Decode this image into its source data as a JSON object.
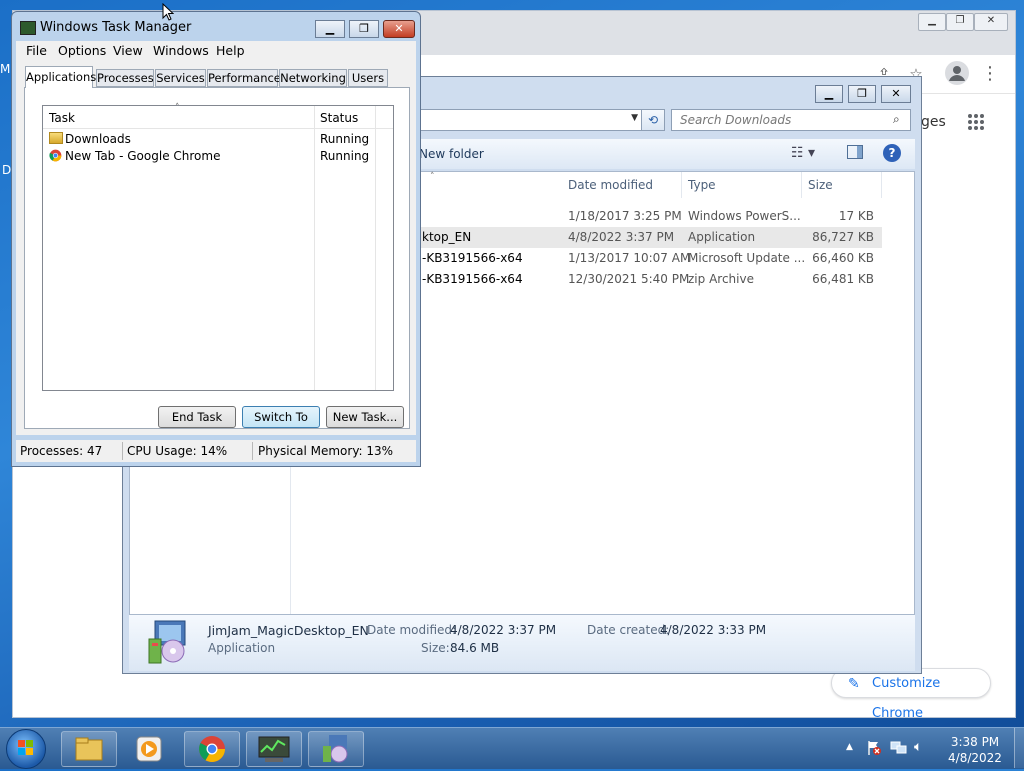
{
  "desktop": {
    "left_letters": [
      "M",
      "D"
    ]
  },
  "chrome": {
    "partial_text": "ges",
    "customize_label": "Customize Chrome",
    "icons": [
      "share-icon",
      "star-icon",
      "profile-icon",
      "menu-icon",
      "apps-grid-icon",
      "pencil-icon"
    ]
  },
  "explorer": {
    "search_placeholder": "Search Downloads",
    "new_folder_label": "New folder",
    "columns": {
      "date": "Date modified",
      "type": "Type",
      "size": "Size"
    },
    "rows": [
      {
        "name": "",
        "date": "1/18/2017 3:25 PM",
        "type": "Windows PowerS...",
        "size": "17 KB"
      },
      {
        "name": "ktop_EN",
        "date": "4/8/2022 3:37 PM",
        "type": "Application",
        "size": "86,727 KB"
      },
      {
        "name": "-KB3191566-x64",
        "date": "1/13/2017 10:07 AM",
        "type": "Microsoft Update ...",
        "size": "66,460 KB"
      },
      {
        "name": "-KB3191566-x64",
        "date": "12/30/2021 5:40 PM",
        "type": "zip Archive",
        "size": "66,481 KB"
      }
    ],
    "details": {
      "name": "JimJam_MagicDesktop_EN",
      "kind": "Application",
      "modified_label": "Date modified:",
      "modified_value": "4/8/2022 3:37 PM",
      "created_label": "Date created:",
      "created_value": "4/8/2022 3:33 PM",
      "size_label": "Size:",
      "size_value": "84.6 MB"
    }
  },
  "taskmanager": {
    "title": "Windows Task Manager",
    "menu": [
      "File",
      "Options",
      "View",
      "Windows",
      "Help"
    ],
    "tabs": [
      "Applications",
      "Processes",
      "Services",
      "Performance",
      "Networking",
      "Users"
    ],
    "columns": {
      "task": "Task",
      "status": "Status"
    },
    "apps": [
      {
        "task": "Downloads",
        "status": "Running"
      },
      {
        "task": "New Tab - Google Chrome",
        "status": "Running"
      }
    ],
    "buttons": {
      "end_task": "End Task",
      "switch_to": "Switch To",
      "new_task": "New Task..."
    },
    "status": {
      "processes": "Processes: 47",
      "cpu": "CPU Usage: 14%",
      "memory": "Physical Memory: 13%"
    }
  },
  "taskbar": {
    "time": "3:38 PM",
    "date": "4/8/2022",
    "items": [
      "explorer",
      "media-player",
      "chrome",
      "task-manager",
      "installer"
    ]
  }
}
